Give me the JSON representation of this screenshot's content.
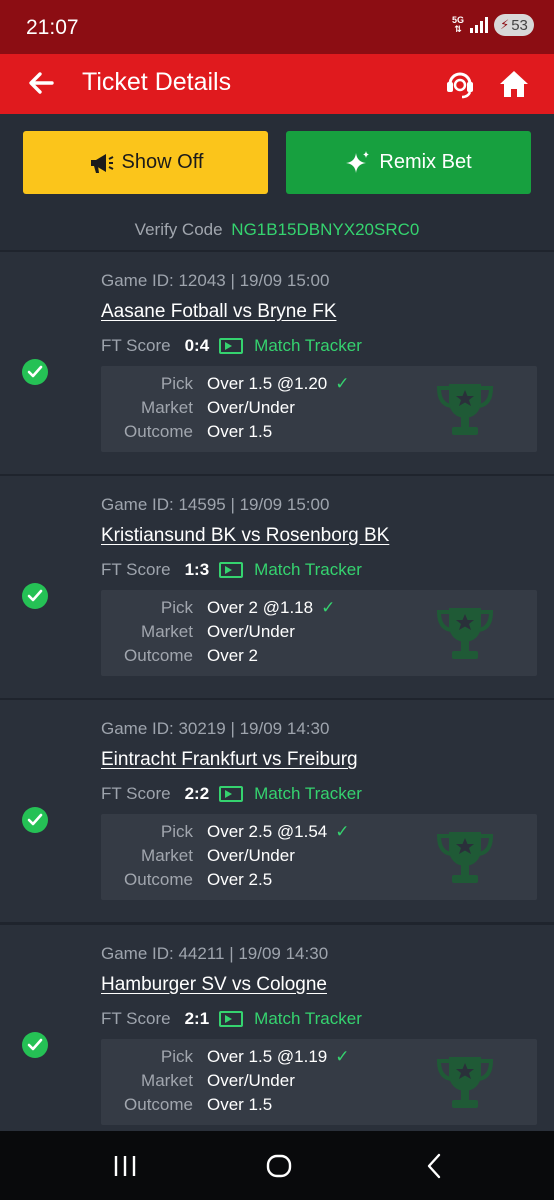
{
  "status_bar": {
    "time": "21:07",
    "network": "5G",
    "battery": "53"
  },
  "header": {
    "title": "Ticket Details"
  },
  "actions": {
    "show_off": "Show Off",
    "remix_bet": "Remix Bet"
  },
  "verify": {
    "label": "Verify Code",
    "code": "NG1B15DBNYX20SRC0"
  },
  "labels": {
    "ft_score": "FT Score",
    "match_tracker": "Match Tracker",
    "pick": "Pick",
    "market": "Market",
    "outcome": "Outcome"
  },
  "colors": {
    "brand_red": "#e01a1e",
    "accent_green": "#35d36f",
    "show_off_yellow": "#fbc51b",
    "remix_green": "#17a03f"
  },
  "games": [
    {
      "meta": "Game ID: 12043 | 19/09 15:00",
      "match": "Aasane Fotball vs Bryne FK",
      "score": "0:4",
      "pick": "Over 1.5 @1.20",
      "market": "Over/Under",
      "outcome": "Over 1.5"
    },
    {
      "meta": "Game ID: 14595 | 19/09 15:00",
      "match": "Kristiansund BK vs Rosenborg BK",
      "score": "1:3",
      "pick": "Over 2 @1.18",
      "market": "Over/Under",
      "outcome": "Over 2"
    },
    {
      "meta": "Game ID: 30219 | 19/09 14:30",
      "match": "Eintracht Frankfurt vs Freiburg",
      "score": "2:2",
      "pick": "Over 2.5 @1.54",
      "market": "Over/Under",
      "outcome": "Over 2.5"
    },
    {
      "meta": "Game ID: 44211 | 19/09 14:30",
      "match": "Hamburger SV vs Cologne",
      "score": "2:1",
      "pick": "Over 1.5 @1.19",
      "market": "Over/Under",
      "outcome": "Over 1.5"
    }
  ]
}
